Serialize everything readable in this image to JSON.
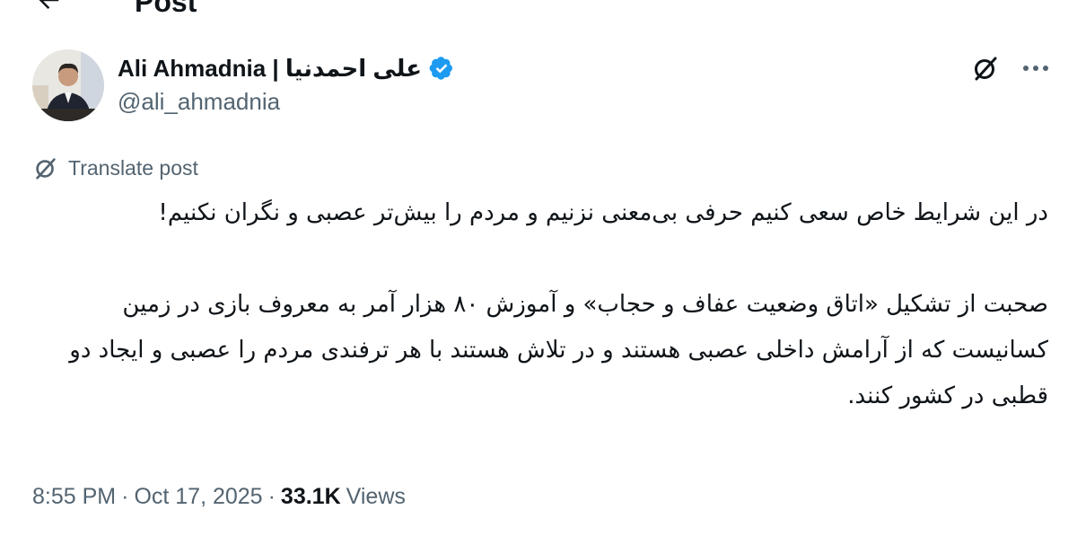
{
  "header": {
    "title": "Post",
    "back_icon": "arrow-left-icon"
  },
  "author": {
    "display_name": "Ali Ahmadnia | علی احمدنیا",
    "handle": "@ali_ahmadnia",
    "verified": true,
    "verified_icon": "verified-badge-icon",
    "verified_color": "#1d9bf0"
  },
  "actions": {
    "grok_icon": "grok-icon",
    "more_icon": "more-dots-icon"
  },
  "translate": {
    "label": "Translate post",
    "icon": "grok-translate-icon"
  },
  "tweet": {
    "paragraph_1": "در این شرایط خاص سعی کنیم حرفی بی‌معنی نزنیم و مردم را بیش‌تر عصبی و نگران نکنیم!",
    "paragraph_2": "صحبت از تشکیل «اتاق وضعیت عفاف و حجاب» و آموزش ۸۰ هزار آمر به معروف بازی در زمین کسانیست که از آرامش داخلی عصبی هستند و در تلاش هستند با هر ترفندی مردم را عصبی و ایجاد دو قطبی در کشور کنند."
  },
  "meta": {
    "time": "8:55 PM",
    "separator": "·",
    "date": "Oct 17, 2025",
    "views_count": "33.1K",
    "views_label": "Views"
  },
  "colors": {
    "text_primary": "#0f1419",
    "text_secondary": "#536471",
    "accent": "#1d9bf0"
  }
}
